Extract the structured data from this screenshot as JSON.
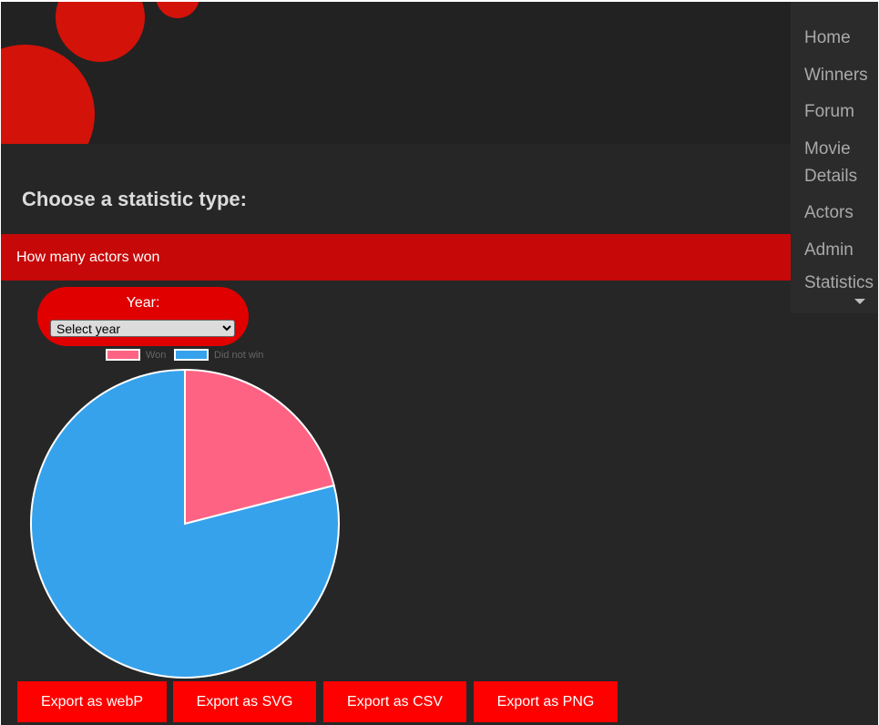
{
  "nav": {
    "items": [
      {
        "label": "Home"
      },
      {
        "label": "Winners"
      },
      {
        "label": "Forum"
      },
      {
        "label": "Movie"
      },
      {
        "label": "Details"
      },
      {
        "label": "Actors"
      },
      {
        "label": "Admin"
      },
      {
        "label": "Statistics"
      }
    ]
  },
  "main": {
    "heading": "Choose a statistic type:",
    "stat_option": "How many actors won",
    "year_label": "Year:",
    "year_select_value": "Select year"
  },
  "chart_data": {
    "type": "pie",
    "labels": [
      "Won",
      "Did not win"
    ],
    "values": [
      21,
      79
    ],
    "colors": [
      "#ff6384",
      "#36a2eb"
    ],
    "legend_position": "top"
  },
  "exports": [
    {
      "label": "Export as webP"
    },
    {
      "label": "Export as SVG"
    },
    {
      "label": "Export as CSV"
    },
    {
      "label": "Export as PNG"
    }
  ],
  "colors": {
    "accent_red": "#e00000",
    "banner_red": "#d3120a",
    "background": "#262626"
  }
}
